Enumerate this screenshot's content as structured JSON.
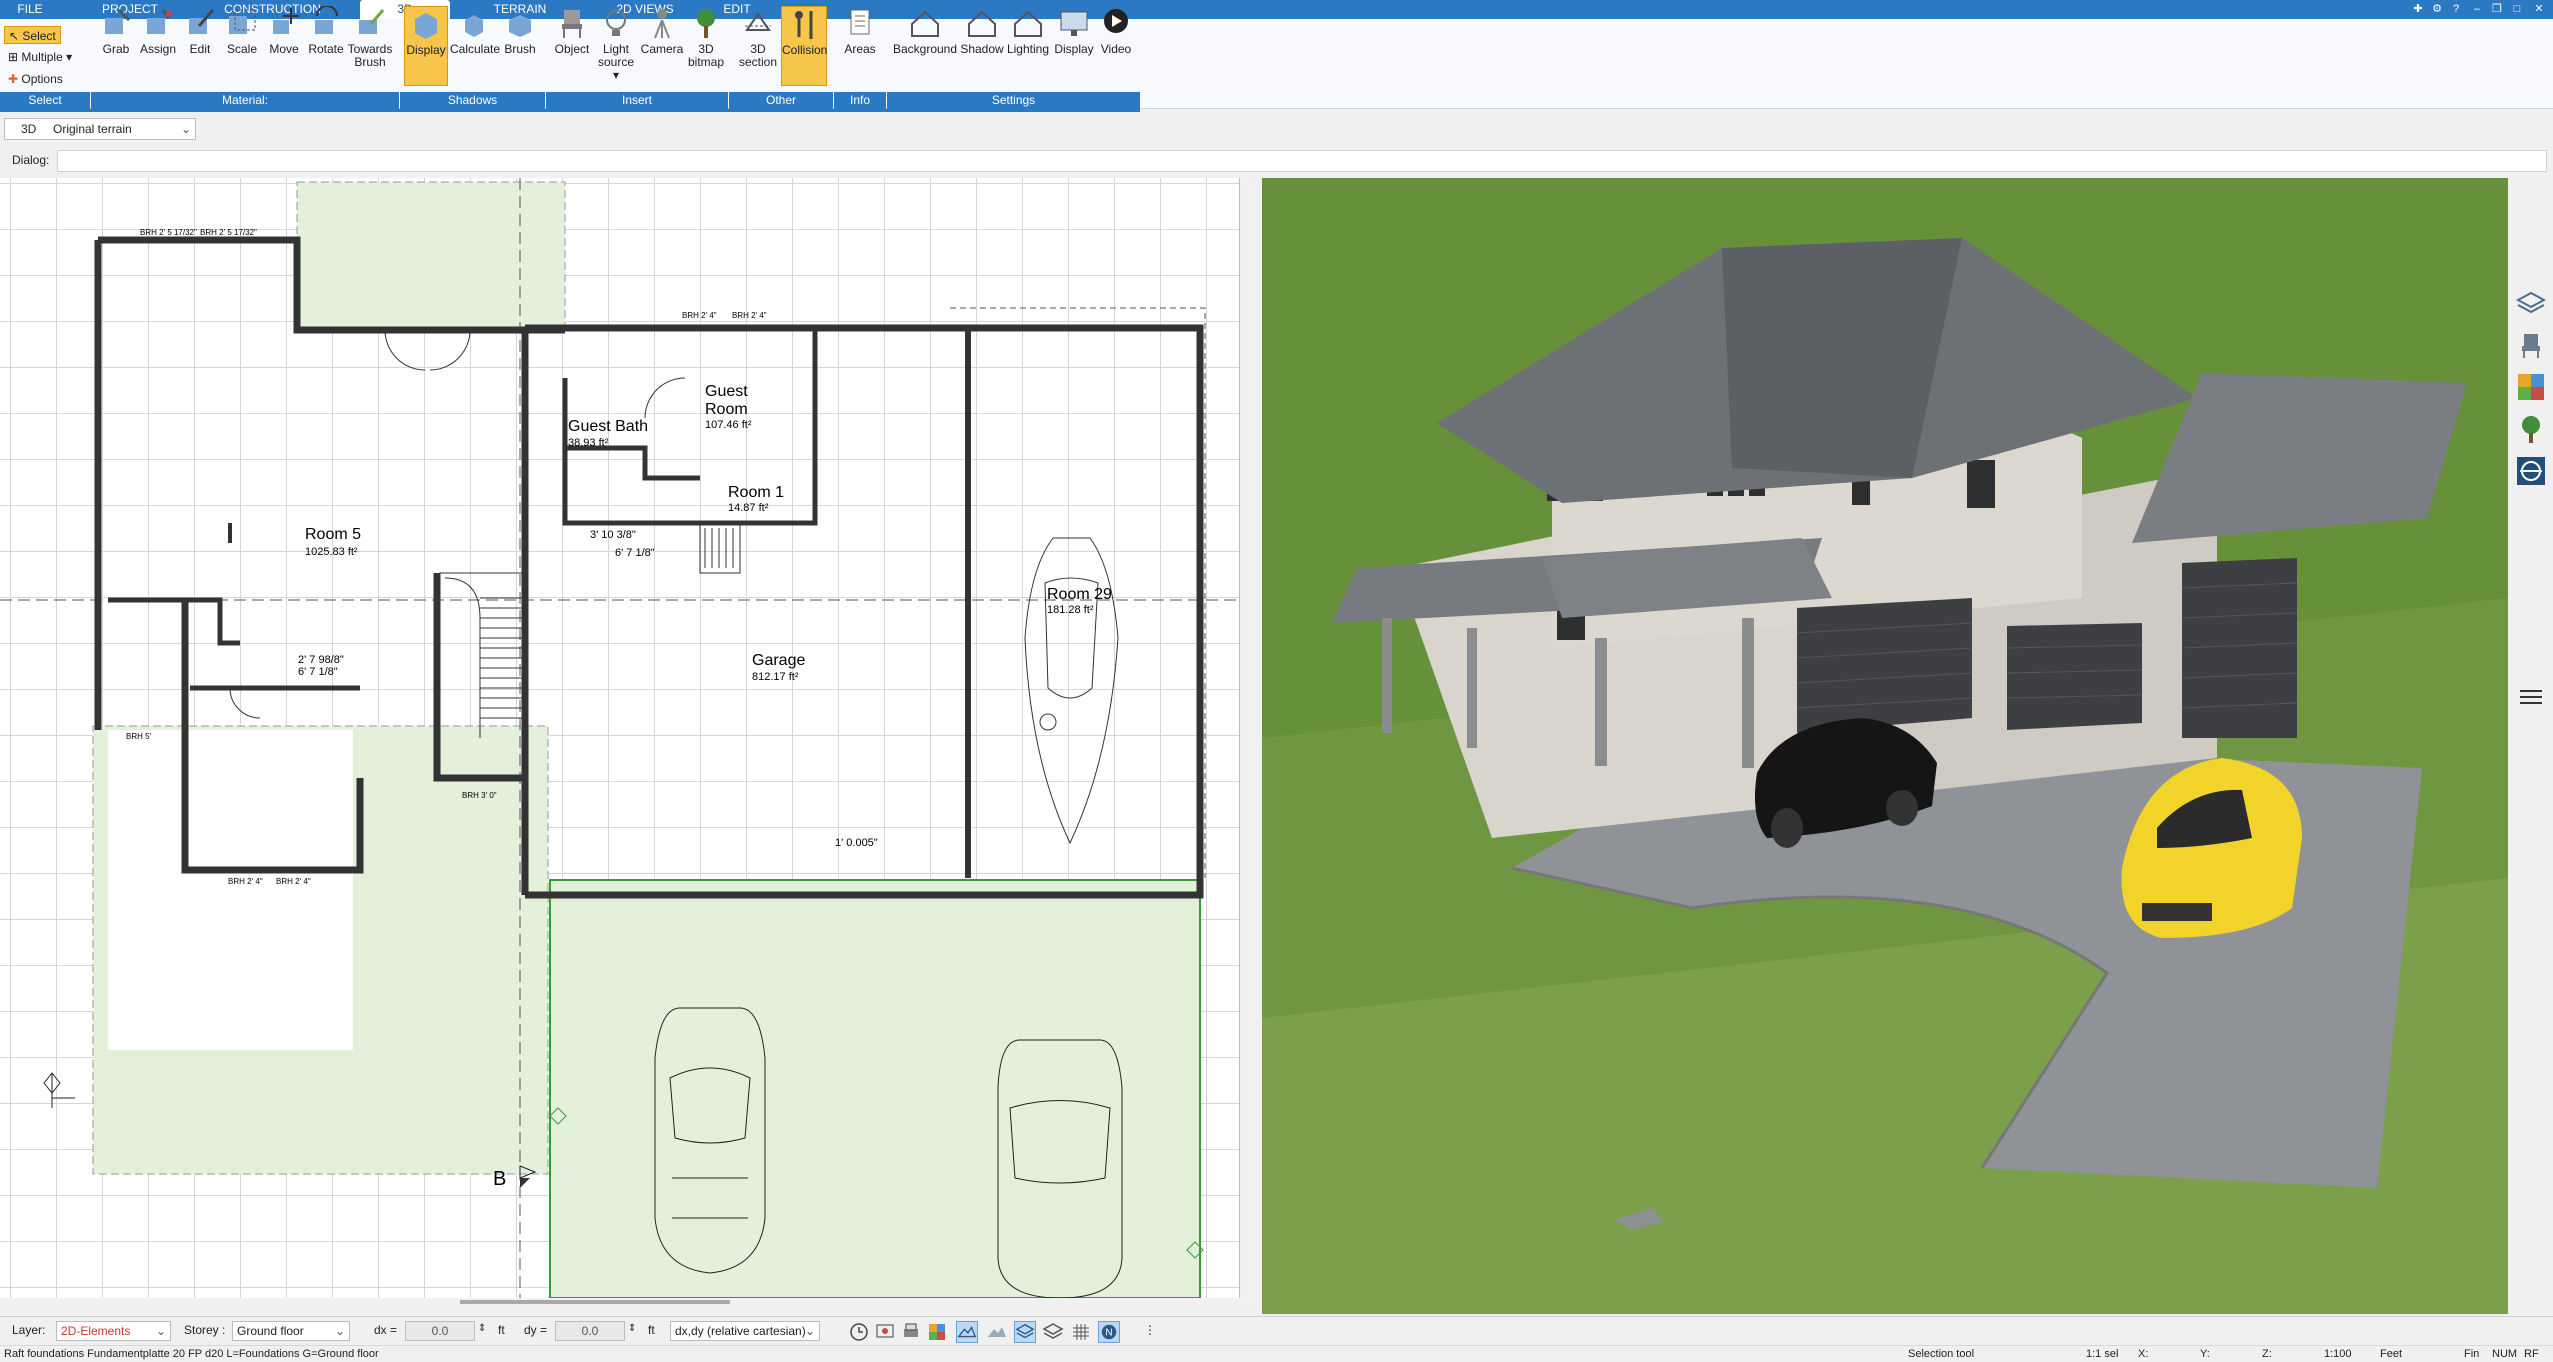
{
  "menu_tabs": [
    "FILE",
    "PROJECT",
    "CONSTRUCTION",
    "3D",
    "TERRAIN",
    "2D VIEWS",
    "EDIT"
  ],
  "active_tab": "3D",
  "left_controls": {
    "select": "Select",
    "multiple": "Multiple",
    "options": "Options"
  },
  "ribbon": {
    "select_group": "Select",
    "material_group": "Material:",
    "material_buttons": [
      "Grab",
      "Assign",
      "Edit",
      "Scale",
      "Move",
      "Rotate"
    ],
    "towards_brush": [
      "Towards",
      "Brush"
    ],
    "shadows_group": "Shadows",
    "shadows_buttons": [
      "Display",
      "Calculate",
      "Brush"
    ],
    "insert_group": "Insert",
    "insert_object": "Object",
    "insert_light": [
      "Light",
      "source ▾"
    ],
    "insert_camera": "Camera",
    "insert_bitmap": [
      "3D",
      "bitmap"
    ],
    "other_group": "Other",
    "other_section": [
      "3D",
      "section"
    ],
    "other_collision": "Collision",
    "info_group": "Info",
    "info_areas": "Areas",
    "settings_group": "Settings",
    "settings_buttons": [
      "Background",
      "Shadow",
      "Lighting",
      "Display",
      "Video"
    ]
  },
  "view": {
    "mode": "3D",
    "terrain": "Original terrain"
  },
  "dialog_label": "Dialog:",
  "plan": {
    "labels": {
      "room5": "Room 5",
      "room5_area": "1025.83 ft²",
      "guest_bath": "Guest Bath",
      "guest_bath_area": "38.93 ft²",
      "guest_room": "Guest",
      "guest_room2": "Room",
      "guest_room_area": "107.46 ft²",
      "room1": "Room 1",
      "room1_area": "14.87 ft²",
      "garage": "Garage",
      "garage_area": "812.17 ft²",
      "room29": "Room 29",
      "room29_area": "181.28 ft²",
      "dim_a": "3' 10 3/8\"",
      "dim_b": "6' 7 1/8\"",
      "dim_c": "1' 0.005\"",
      "dim_d": "2' 7 98/8\"",
      "dim_e": "6' 7 1/8\"",
      "brh1": "BRH  2' 5 17/32\"",
      "brh2": "BRH  2' 5 17/32\"",
      "brh3": "BRH  2' 4\"",
      "brh4": "BRH  2' 4\"",
      "brh5": "BRH  2' 4\"",
      "brh6": "BRH  2' 4\"",
      "brh7": "BRH  5'",
      "brh8": "BRH  3' 0\"",
      "section_mark": "B"
    }
  },
  "statusbar": {
    "layer_label": "Layer:",
    "layer_value": "2D-Elements",
    "storey_label": "Storey :",
    "storey_value": "Ground floor",
    "dx_label": "dx =",
    "dx_value": "0.0",
    "dy_label": "dy =",
    "dy_value": "0.0",
    "unit": "ft",
    "coord_mode": "dx,dy (relative cartesian)"
  },
  "infobar": {
    "left": "Raft foundations Fundamentplatte 20 FP d20 L=Foundations G=Ground floor",
    "tool": "Selection tool",
    "sel": "1:1 sel",
    "x": "X:",
    "y": "Y:",
    "z": "Z:",
    "scale": "1:100",
    "units": "Feet",
    "fin": "Fin",
    "num": "NUM",
    "rf": "RF"
  },
  "colors": {
    "accent": "#2b79c2",
    "active": "#f6c54a",
    "plan_green": "#e3f0da",
    "grass": "#6f9640"
  }
}
